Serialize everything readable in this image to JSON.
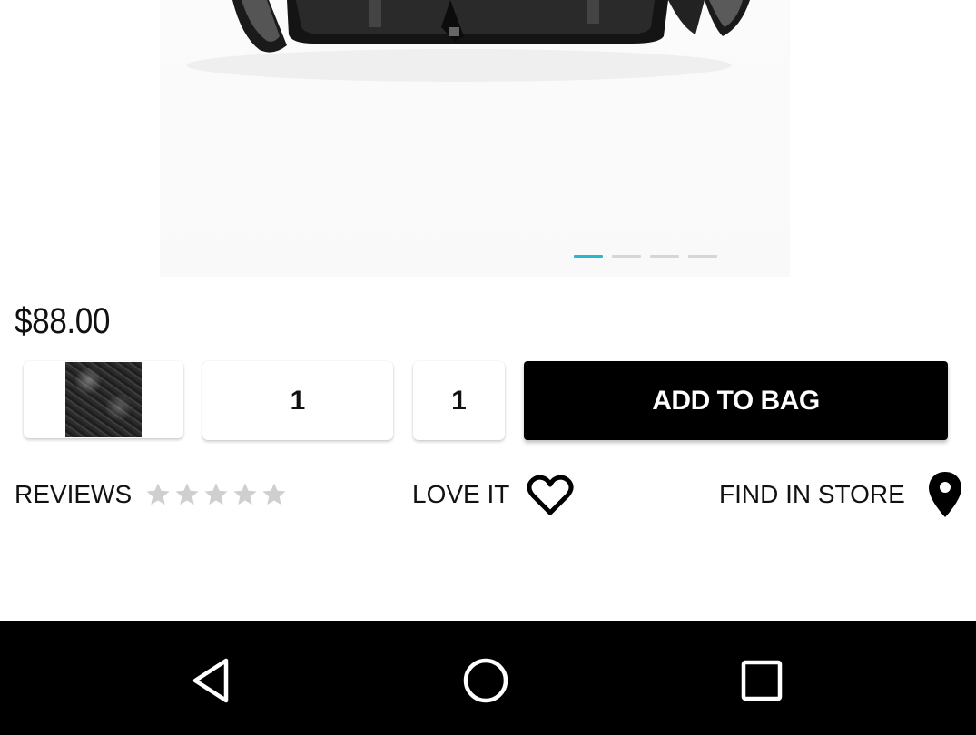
{
  "product": {
    "price": "$88.00",
    "size_value": "1",
    "quantity_value": "1",
    "image_pages": 4,
    "active_page": 1
  },
  "actions": {
    "add_to_bag_label": "ADD TO BAG",
    "reviews_label": "REVIEWS",
    "rating_stars": 5,
    "rating_value": 0,
    "love_label": "LOVE IT",
    "find_store_label": "FIND IN STORE"
  },
  "colors": {
    "accent": "#29b6d0",
    "primary_button": "#000000",
    "star_inactive": "#cfcfcf"
  },
  "icons": {
    "love": "heart-outline-icon",
    "store": "location-pin-icon",
    "nav_back": "back-triangle-icon",
    "nav_home": "home-circle-icon",
    "nav_recent": "recents-square-icon"
  }
}
